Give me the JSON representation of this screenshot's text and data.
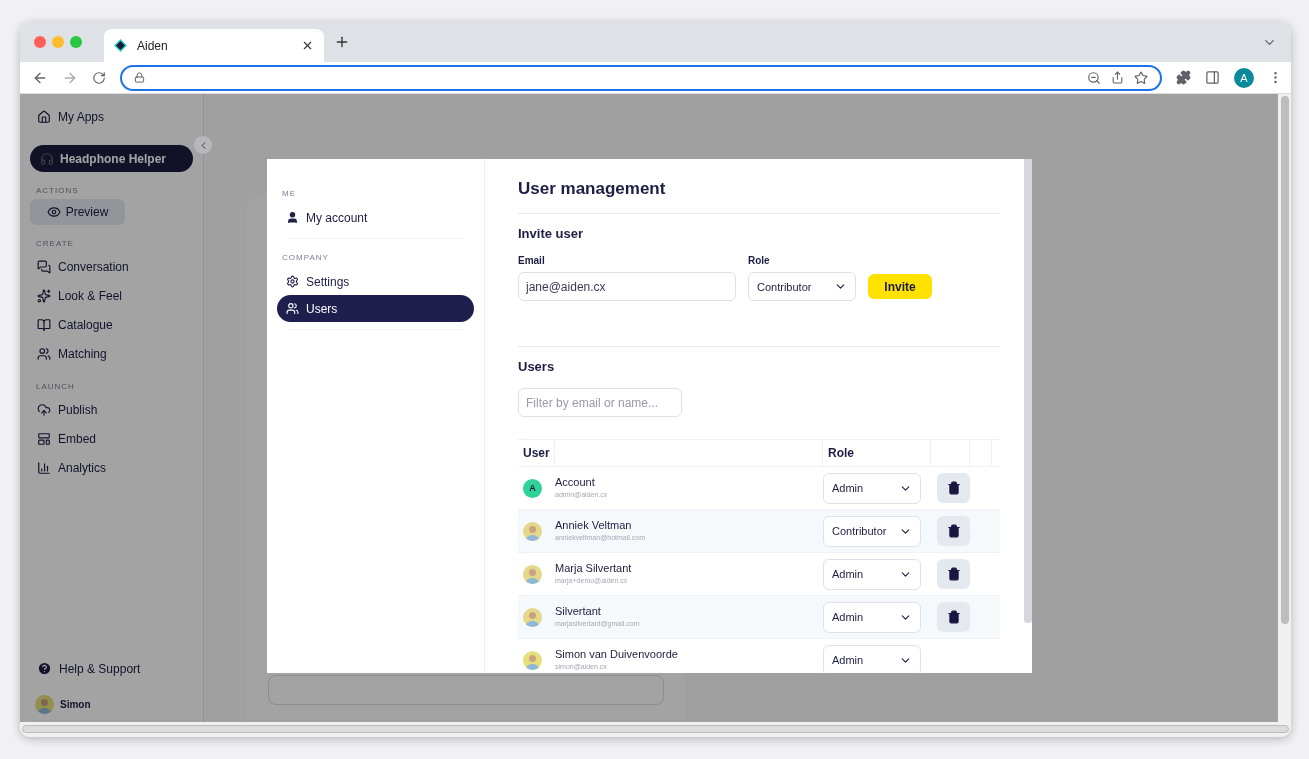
{
  "browser": {
    "tab_title": "Aiden",
    "profile_initial": "A"
  },
  "sidebar": {
    "home": "My Apps",
    "app_name": "Headphone Helper",
    "sections": [
      {
        "label": "ACTIONS",
        "kind": "button",
        "items": [
          {
            "label": "Preview",
            "selected": false
          }
        ]
      },
      {
        "label": "CREATE",
        "kind": "links",
        "items": [
          {
            "label": "Conversation",
            "selected": false
          },
          {
            "label": "Look & Feel",
            "selected": false
          },
          {
            "label": "Catalogue",
            "selected": false
          },
          {
            "label": "Matching",
            "selected": false
          }
        ]
      },
      {
        "label": "LAUNCH",
        "kind": "links",
        "items": [
          {
            "label": "Publish",
            "selected": false
          },
          {
            "label": "Embed",
            "selected": false
          },
          {
            "label": "Analytics",
            "selected": false
          }
        ]
      }
    ],
    "help": "Help & Support",
    "user_name": "Simon"
  },
  "modal": {
    "nav": [
      {
        "label": "ME",
        "items": [
          {
            "label": "My account",
            "selected": false
          }
        ]
      },
      {
        "label": "COMPANY",
        "items": [
          {
            "label": "Settings",
            "selected": false
          },
          {
            "label": "Users",
            "selected": true
          }
        ]
      }
    ],
    "title": "User management",
    "invite": {
      "heading": "Invite user",
      "email_label": "Email",
      "email_value": "jane@aiden.cx",
      "role_label": "Role",
      "role_value": "Contributor",
      "button": "Invite"
    },
    "users": {
      "heading": "Users",
      "filter_placeholder": "Filter by email or name...",
      "columns": [
        {
          "label": "User"
        },
        {
          "label": "Role"
        }
      ],
      "rows": [
        {
          "initial": "A",
          "name": "Account",
          "email": "admin@aiden.cx",
          "role": "Admin",
          "deletable": true
        },
        {
          "name": "Anniek Veltman",
          "email": "anniekveltman@hotmail.com",
          "role": "Contributor",
          "deletable": true
        },
        {
          "name": "Marja Silvertant",
          "email": "marja+demo@aiden.cx",
          "role": "Admin",
          "deletable": true
        },
        {
          "name": "Silvertant",
          "email": "marjasilvertant@gmail.com",
          "role": "Admin",
          "deletable": true
        },
        {
          "name": "Simon van Duivenvoorde",
          "email": "simon@aiden.cx",
          "role": "Admin",
          "deletable": false
        }
      ]
    }
  }
}
